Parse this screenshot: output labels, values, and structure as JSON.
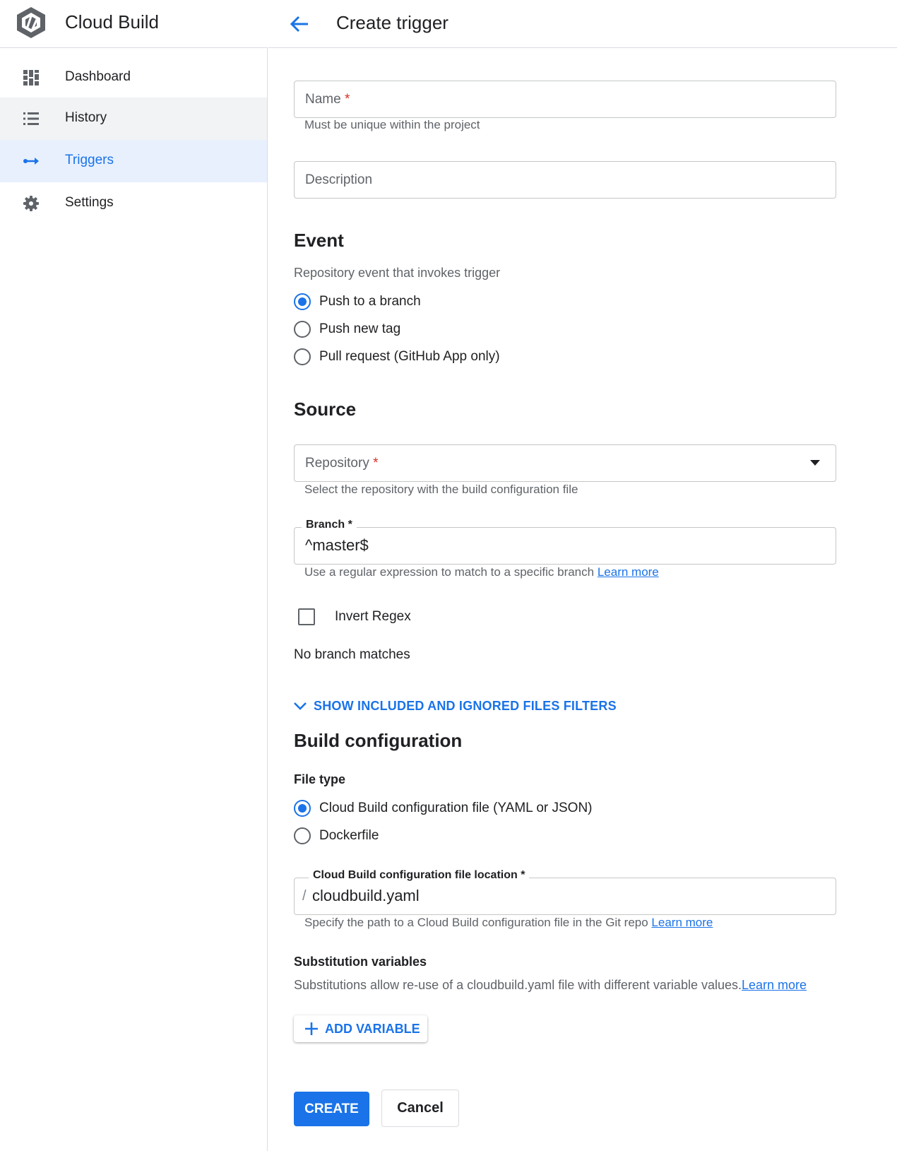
{
  "app": {
    "title": "Cloud Build",
    "logo_icon": "cloud-build-hexagon-icon",
    "accent_color": "#1a73e8"
  },
  "sidebar": {
    "items": [
      {
        "label": "Dashboard",
        "icon": "dashboard-icon",
        "state": "normal"
      },
      {
        "label": "History",
        "icon": "list-icon",
        "state": "hover"
      },
      {
        "label": "Triggers",
        "icon": "triggers-arrow-icon",
        "state": "active"
      },
      {
        "label": "Settings",
        "icon": "gear-icon",
        "state": "normal"
      }
    ]
  },
  "header": {
    "back_icon": "arrow-back-icon",
    "title": "Create trigger"
  },
  "form": {
    "name": {
      "placeholder": "Name",
      "required_mark": "*",
      "hint": "Must be unique within the project",
      "value": ""
    },
    "description": {
      "placeholder": "Description",
      "value": ""
    },
    "event": {
      "heading": "Event",
      "subheading": "Repository event that invokes trigger",
      "options": [
        {
          "label": "Push to a branch",
          "selected": true
        },
        {
          "label": "Push new tag",
          "selected": false
        },
        {
          "label": "Pull request (GitHub App only)",
          "selected": false
        }
      ]
    },
    "source": {
      "heading": "Source",
      "repository": {
        "placeholder": "Repository",
        "required_mark": "*",
        "hint": "Select the repository with the build configuration file"
      },
      "branch": {
        "label": "Branch *",
        "value": "^master$",
        "hint": "Use a regular expression to match to a specific branch",
        "learn_more": "Learn more"
      },
      "invert_regex": {
        "label": "Invert Regex",
        "checked": false
      },
      "branch_matches": "No branch matches",
      "filters_toggle": "SHOW INCLUDED AND IGNORED FILES FILTERS"
    },
    "build_config": {
      "heading": "Build configuration",
      "file_type_label": "File type",
      "options": [
        {
          "label": "Cloud Build configuration file (YAML or JSON)",
          "selected": true
        },
        {
          "label": "Dockerfile",
          "selected": false
        }
      ],
      "location": {
        "label": "Cloud Build configuration file location *",
        "prefix": "/",
        "value": "cloudbuild.yaml",
        "hint": "Specify the path to a Cloud Build configuration file in the Git repo",
        "learn_more": "Learn more"
      }
    },
    "substitutions": {
      "heading": "Substitution variables",
      "description": "Substitutions allow re-use of a cloudbuild.yaml file with different variable values.",
      "learn_more": "Learn more",
      "add_button": "ADD VARIABLE"
    },
    "actions": {
      "create": "CREATE",
      "cancel": "Cancel"
    }
  }
}
